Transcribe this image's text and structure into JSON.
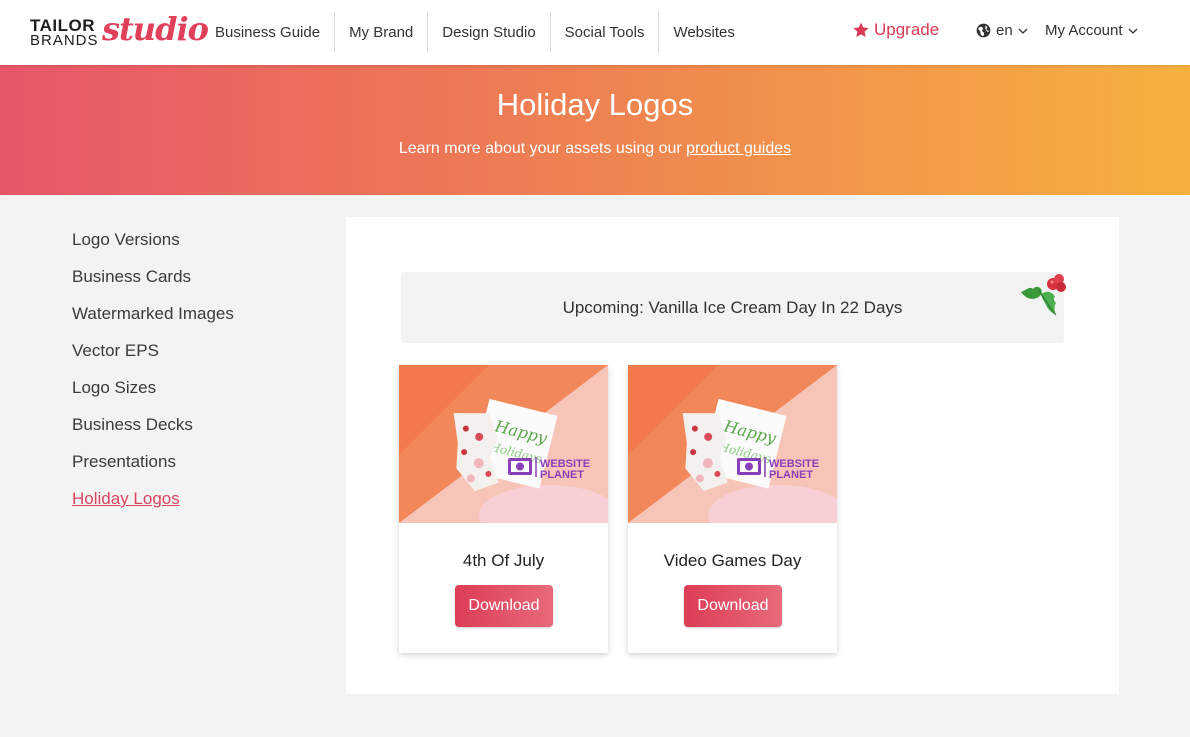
{
  "brand": {
    "line1": "TAILOR",
    "line2": "BRANDS",
    "script": "studio",
    "accent": "#e0405a"
  },
  "nav": {
    "items": [
      "Business Guide",
      "My Brand",
      "Design Studio",
      "Social Tools",
      "Websites"
    ]
  },
  "header_right": {
    "upgrade": "Upgrade",
    "language": "en",
    "account": "My Account"
  },
  "hero": {
    "title": "Holiday Logos",
    "subtitle_prefix": "Learn more about your assets using our ",
    "subtitle_link": "product guides",
    "gradient": [
      "#e8566a",
      "#f6b13f"
    ]
  },
  "sidebar": {
    "items": [
      {
        "label": "Logo Versions"
      },
      {
        "label": "Business Cards"
      },
      {
        "label": "Watermarked Images"
      },
      {
        "label": "Vector EPS"
      },
      {
        "label": "Logo Sizes"
      },
      {
        "label": "Business Decks"
      },
      {
        "label": "Presentations"
      },
      {
        "label": "Holiday Logos",
        "active": true
      }
    ]
  },
  "banner": {
    "text": "Upcoming: Vanilla Ice Cream Day In 22 Days"
  },
  "cards": [
    {
      "title": "4th Of July",
      "button": "Download",
      "image_text": "WEBSITE PLANET"
    },
    {
      "title": "Video Games Day",
      "button": "Download",
      "image_text": "WEBSITE PLANET"
    }
  ],
  "colors": {
    "accent": "#d94560",
    "button": "#dd3d57",
    "panel_bg": "#ffffff",
    "page_bg": "#f4f3f3"
  }
}
